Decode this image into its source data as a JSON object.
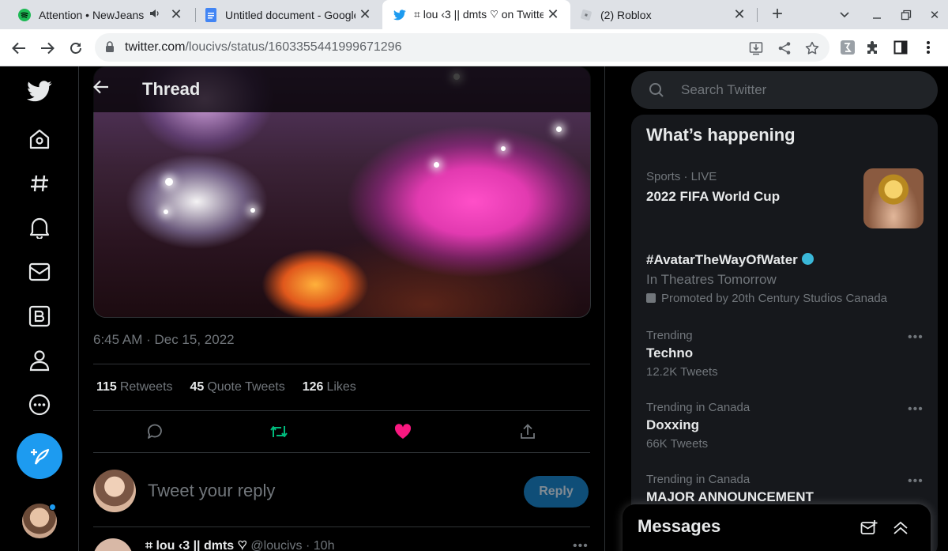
{
  "browser": {
    "tabs": [
      {
        "title": "Attention • NewJeans",
        "favicon": "spotify-icon"
      },
      {
        "title": "Untitled document - Google",
        "favicon": "google-docs-icon"
      },
      {
        "title": "⌗ lou ‹3 || dmts ♡ on Twitte",
        "favicon": "twitter-icon",
        "active": true
      },
      {
        "title": "(2) Roblox",
        "favicon": "roblox-icon"
      }
    ],
    "url_domain": "twitter.com",
    "url_path": "/loucivs/status/1603355441999671296"
  },
  "header": {
    "title": "Thread"
  },
  "tweet": {
    "timestamp": "6:45 AM · Dec 15, 2022",
    "retweets_count": "115",
    "retweets_label": "Retweets",
    "quotes_count": "45",
    "quotes_label": "Quote Tweets",
    "likes_count": "126",
    "likes_label": "Likes",
    "liked": true
  },
  "reply": {
    "placeholder": "Tweet your reply",
    "button": "Reply"
  },
  "next_tweet": {
    "name": "⌗ lou ‹3 || dmts ♡",
    "handle_time": "@loucivs · 10h"
  },
  "search": {
    "placeholder": "Search Twitter"
  },
  "trends": {
    "title": "What’s happening",
    "items": [
      {
        "meta": "Sports · LIVE",
        "title": "2022 FIFA World Cup"
      },
      {
        "title": "#AvatarTheWayOfWater",
        "sub": "In Theatres Tomorrow",
        "promo": "Promoted by 20th Century Studios Canada"
      },
      {
        "meta": "Trending",
        "title": "Techno",
        "sub": "12.2K Tweets"
      },
      {
        "meta": "Trending in Canada",
        "title": "Doxxing",
        "sub": "66K Tweets"
      },
      {
        "meta": "Trending in Canada",
        "title": "MAJOR ANNOUNCEMENT"
      }
    ]
  },
  "messages": {
    "title": "Messages"
  },
  "colors": {
    "accent": "#1d9bf0",
    "like": "#f91880",
    "retweet": "#00ba7c",
    "background": "#000000"
  }
}
